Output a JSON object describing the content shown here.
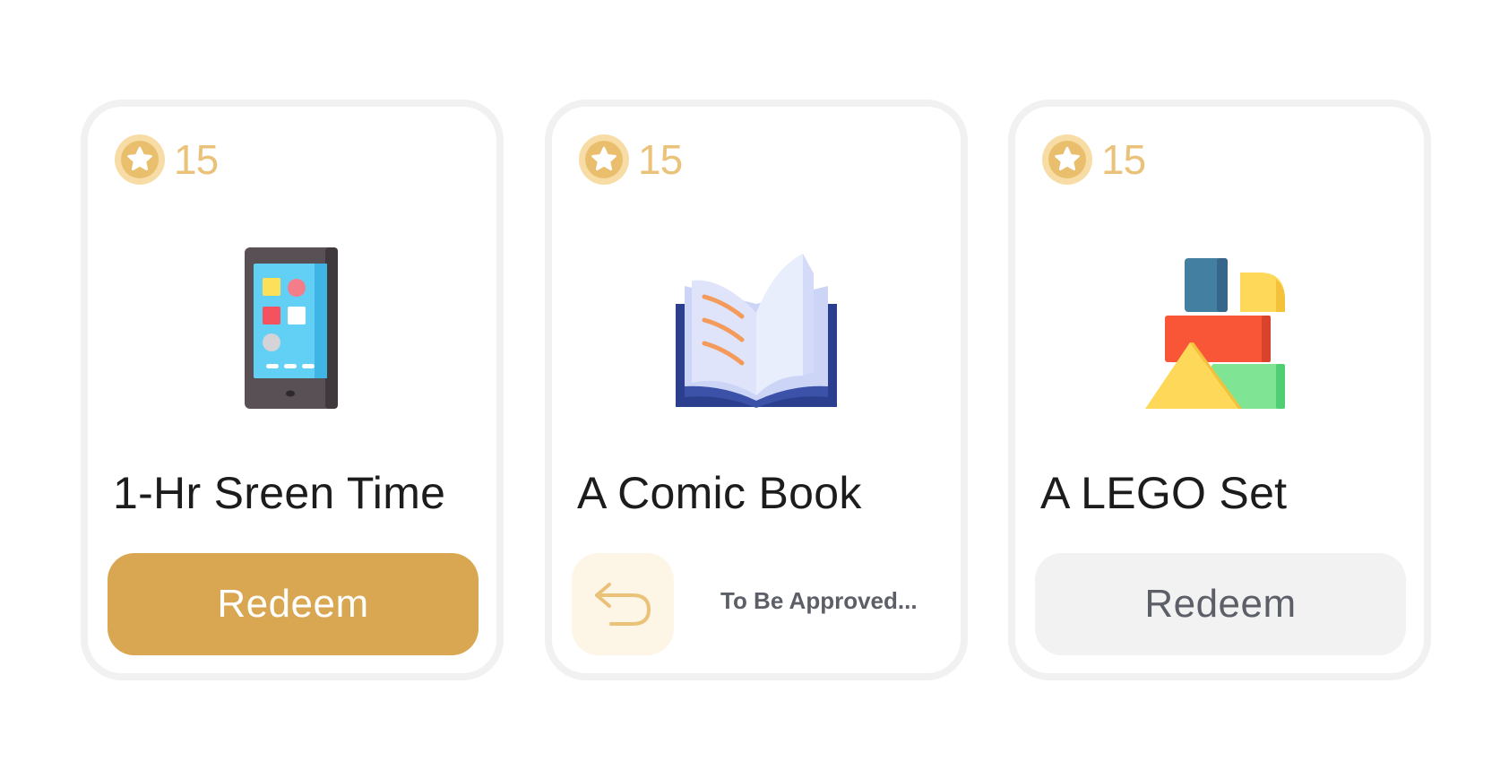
{
  "rewards": [
    {
      "points": "15",
      "title": "1-Hr Sreen Time",
      "illustration": "smartphone-icon",
      "action": {
        "type": "button",
        "label": "Redeem",
        "state": "active"
      }
    },
    {
      "points": "15",
      "title": "A Comic Book",
      "illustration": "open-book-icon",
      "action": {
        "type": "pending",
        "label": "To Be Approved...",
        "icon": "undo-arrow-icon"
      }
    },
    {
      "points": "15",
      "title": "A LEGO Set",
      "illustration": "building-blocks-icon",
      "action": {
        "type": "button",
        "label": "Redeem",
        "state": "disabled"
      }
    }
  ],
  "colors": {
    "accent": "#d9a651",
    "coin": "#eac27a",
    "coin_light": "#f7dca5",
    "disabled_bg": "#f2f2f2",
    "pending_bg": "#fdf5e6",
    "card_border": "#f1f1f1",
    "title_text": "#1c1c1c",
    "muted_text": "#5d5f68"
  }
}
